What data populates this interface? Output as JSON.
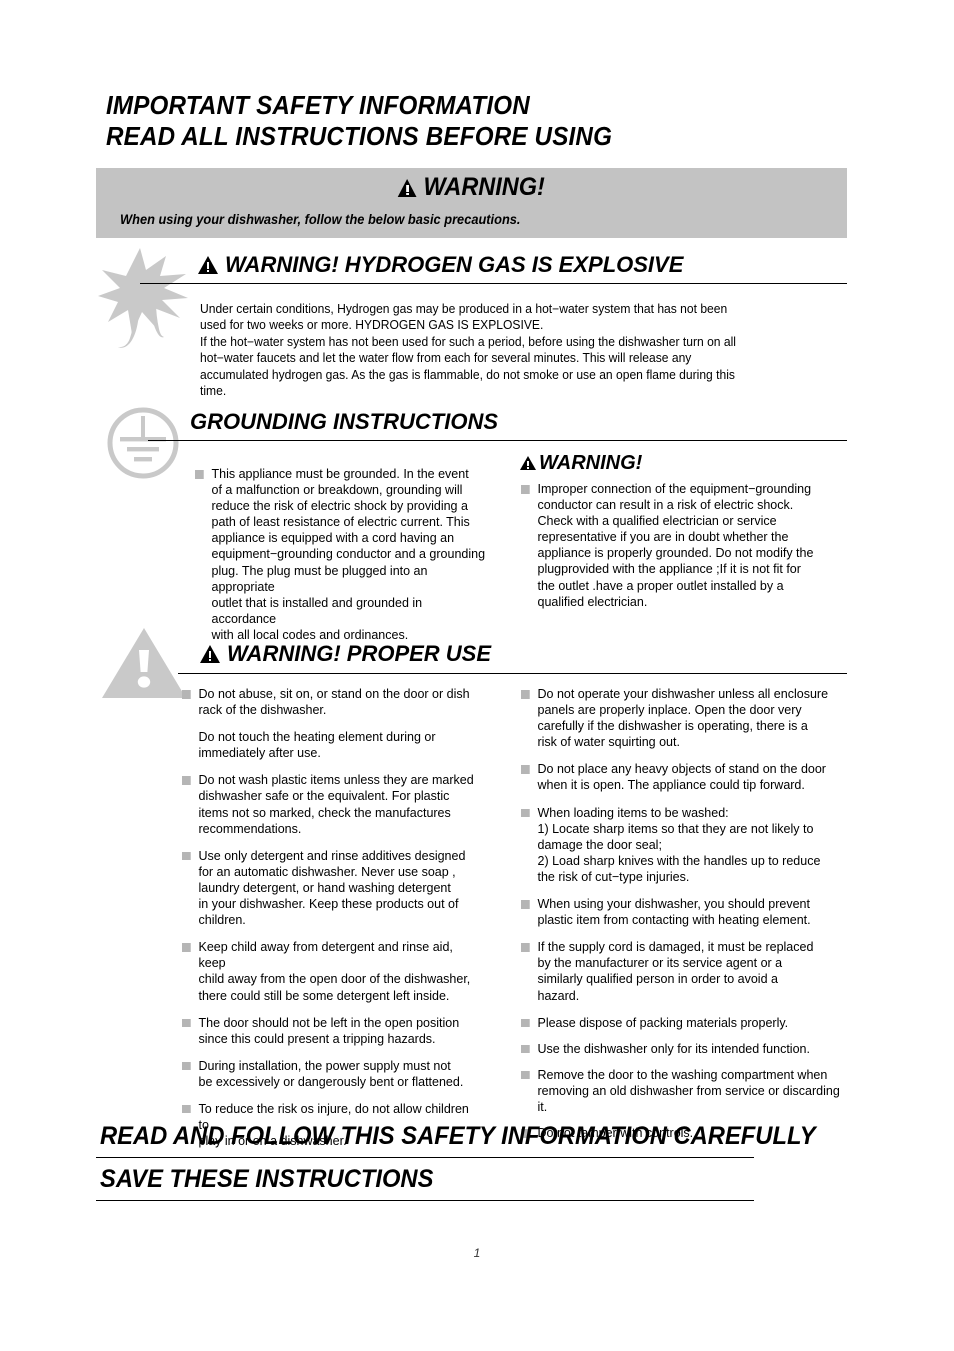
{
  "document": {
    "title_line1": "IMPORTANT SAFETY INFORMATION",
    "title_line2": "READ ALL INSTRUCTIONS BEFORE USING",
    "page_number": "1"
  },
  "banner": {
    "title": "WARNING!",
    "subtitle": "When using your dishwasher, follow the below basic precautions.",
    "background_color": "#c3c3c3"
  },
  "hydrogen": {
    "icon": "explosion-burst-icon",
    "heading": "WARNING! HYDROGEN GAS IS EXPLOSIVE",
    "body": "Under certain conditions, Hydrogen gas may be produced in a hot−water system that has not been\nused for two weeks or more. HYDROGEN GAS IS EXPLOSIVE.\nIf the hot−water system has not been used for such a period, before using the dishwasher turn on all\nhot−water faucets and let the water flow from each for several minutes. This will release any\naccumulated hydrogen gas. As the gas is flammable,  do not smoke or use an open flame during this\ntime."
  },
  "grounding": {
    "icon": "earth-ground-icon",
    "heading": "GROUNDING INSTRUCTIONS",
    "left_items": [
      "This appliance must be grounded. In the event\nof a malfunction or breakdown, grounding will\nreduce the risk of electric shock by providing a\npath of least resistance of electric current. This\nappliance is equipped with a cord having an\nequipment−grounding conductor and a grounding\nplug. The plug must be plugged into an appropriate\noutlet that is installed and grounded in accordance\nwith all local codes and ordinances."
    ],
    "warning_title": "WARNING!",
    "right_items": [
      "Improper connection of the equipment−grounding\nconductor can result in a risk of electric shock.\nCheck with a qualified electrician or service\nrepresentative if you are in doubt whether the\nappliance is properly grounded. Do not modify the\nplugprovided with the appliance ;If it is not  fit for\nthe outlet .have a proper outlet installed by a\nqualified electrician."
    ]
  },
  "proper_use": {
    "icon": "warning-triangle-icon",
    "heading": "WARNING! PROPER USE",
    "left_items": [
      {
        "marker": true,
        "text": "Do not abuse, sit on, or stand on the door or dish\nrack of the dishwasher."
      },
      {
        "marker": false,
        "text": "Do not touch the heating element during or\nimmediately after use."
      },
      {
        "marker": true,
        "text": "Do not wash plastic items unless they are marked\ndishwasher safe  or the equivalent. For plastic\nitems   not so marked, check the manufactures\nrecommendations."
      },
      {
        "marker": true,
        "text": "Use only detergent and rinse additives designed\nfor an automatic dishwasher. Never use soap ,\nlaundry detergent, or hand washing detergent\nin your dishwasher. Keep these products out  of\nchildren."
      },
      {
        "marker": true,
        "text": "Keep child away from detergent and rinse aid, keep\nchild away from the open door of the dishwasher,\nthere could still be some detergent left inside."
      },
      {
        "marker": true,
        "text": "The door should not be left in the open position\nsince this could present a tripping hazards."
      },
      {
        "marker": true,
        "text": "During installation, the power supply must not\nbe excessively or dangerously bent or flattened."
      },
      {
        "marker": true,
        "text": "To reduce the risk os injure, do not allow children to\nplay in or on a dishwasher."
      }
    ],
    "right_items": [
      {
        "marker": true,
        "text": "Do not operate your dishwasher unless all enclosure\npanels are properly inplace. Open the door very\ncarefully if the dishwasher is operating, there is a\nrisk of water squirting out."
      },
      {
        "marker": true,
        "text": "Do not place any heavy objects of stand on the door\nwhen it is open. The appliance could tip forward."
      },
      {
        "marker": true,
        "text": "When loading items to be washed:\n1) Locate sharp items so that they  are not likely to\ndamage the door seal;\n2) Load sharp knives with the handles up to reduce\nthe risk of cut−type injuries."
      },
      {
        "marker": true,
        "text": "When using your dishwasher, you should prevent\nplastic item from contacting with heating element."
      },
      {
        "marker": true,
        "text": "If the supply cord is damaged, it must be replaced\nby the manufacturer or its service agent or a\nsimilarly qualified person in order to avoid a\nhazard."
      },
      {
        "marker": true,
        "text": "Please dispose of packing materials properly."
      },
      {
        "marker": true,
        "text": "Use the dishwasher only for its intended function."
      },
      {
        "marker": true,
        "text": "Remove the door to the washing compartment when\nremoving an old dishwasher from service or discarding it."
      },
      {
        "marker": true,
        "text": "Do not tamper with controls."
      }
    ]
  },
  "footer": {
    "line1": "READ AND FOLLOW THIS SAFETY INFORMATION CAREFULLY",
    "line2": "SAVE THESE INSTRUCTIONS"
  }
}
